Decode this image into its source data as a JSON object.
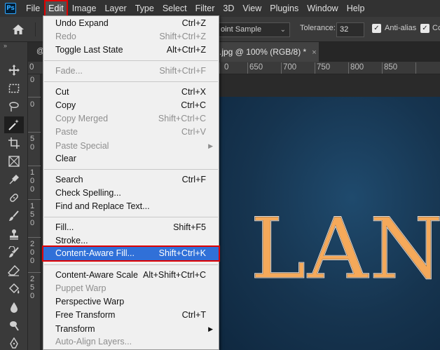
{
  "app": {
    "logo": "Ps"
  },
  "menubar": {
    "items": [
      "File",
      "Edit",
      "Image",
      "Layer",
      "Type",
      "Select",
      "Filter",
      "3D",
      "View",
      "Plugins",
      "Window",
      "Help"
    ],
    "active": "Edit"
  },
  "options": {
    "sample_value": "oint Sample",
    "tolerance_label": "Tolerance:",
    "tolerance_value": "32",
    "antialias_label": "Anti-alias",
    "contiguous_label": "Co"
  },
  "tabs": {
    "left_partial": "@",
    "doc_title": ".jpg @ 100% (RGB/8) *",
    "close_glyph": "×",
    "collapse_glyph": "»"
  },
  "ruler": {
    "top_labels": [
      "0",
      "650",
      "700",
      "750",
      "800",
      "850"
    ],
    "left_digits": [
      [
        "0"
      ],
      [
        "0"
      ],
      [
        "5",
        "0"
      ],
      [
        "1",
        "0",
        "0"
      ],
      [
        "1",
        "5",
        "0"
      ],
      [
        "2",
        "0",
        "0"
      ],
      [
        "2",
        "5",
        "0"
      ]
    ]
  },
  "artwork": {
    "text": "LAN"
  },
  "edit_menu": {
    "items": [
      {
        "label": "Undo Expand",
        "shortcut": "Ctrl+Z",
        "disabled": false
      },
      {
        "label": "Redo",
        "shortcut": "Shift+Ctrl+Z",
        "disabled": true
      },
      {
        "label": "Toggle Last State",
        "shortcut": "Alt+Ctrl+Z",
        "disabled": false
      },
      {
        "label": "Fade...",
        "shortcut": "Shift+Ctrl+F",
        "disabled": true
      },
      {
        "label": "Cut",
        "shortcut": "Ctrl+X",
        "disabled": false
      },
      {
        "label": "Copy",
        "shortcut": "Ctrl+C",
        "disabled": false
      },
      {
        "label": "Copy Merged",
        "shortcut": "Shift+Ctrl+C",
        "disabled": true
      },
      {
        "label": "Paste",
        "shortcut": "Ctrl+V",
        "disabled": true
      },
      {
        "label": "Paste Special",
        "shortcut": "",
        "disabled": true,
        "submenu": true
      },
      {
        "label": "Clear",
        "shortcut": "",
        "disabled": false
      },
      {
        "label": "Search",
        "shortcut": "Ctrl+F",
        "disabled": false
      },
      {
        "label": "Check Spelling...",
        "shortcut": "",
        "disabled": false
      },
      {
        "label": "Find and Replace Text...",
        "shortcut": "",
        "disabled": false
      },
      {
        "label": "Fill...",
        "shortcut": "Shift+F5",
        "disabled": false
      },
      {
        "label": "Stroke...",
        "shortcut": "",
        "disabled": false
      },
      {
        "label": "Content-Aware Fill...",
        "shortcut": "Shift+Ctrl+K",
        "disabled": false,
        "highlighted": true
      },
      {
        "label": "Content-Aware Scale",
        "shortcut": "Alt+Shift+Ctrl+C",
        "disabled": false
      },
      {
        "label": "Puppet Warp",
        "shortcut": "",
        "disabled": true
      },
      {
        "label": "Perspective Warp",
        "shortcut": "",
        "disabled": false
      },
      {
        "label": "Free Transform",
        "shortcut": "Ctrl+T",
        "disabled": false
      },
      {
        "label": "Transform",
        "shortcut": "",
        "disabled": false,
        "submenu": true
      },
      {
        "label": "Auto-Align Layers...",
        "shortcut": "",
        "disabled": true
      }
    ],
    "submenu_glyph": "▶"
  },
  "colors": {
    "highlight": "#3070d8",
    "highlight_outline": "#e00000",
    "artwork_text": "#f5a95a",
    "artwork_bg": "#16344f"
  }
}
